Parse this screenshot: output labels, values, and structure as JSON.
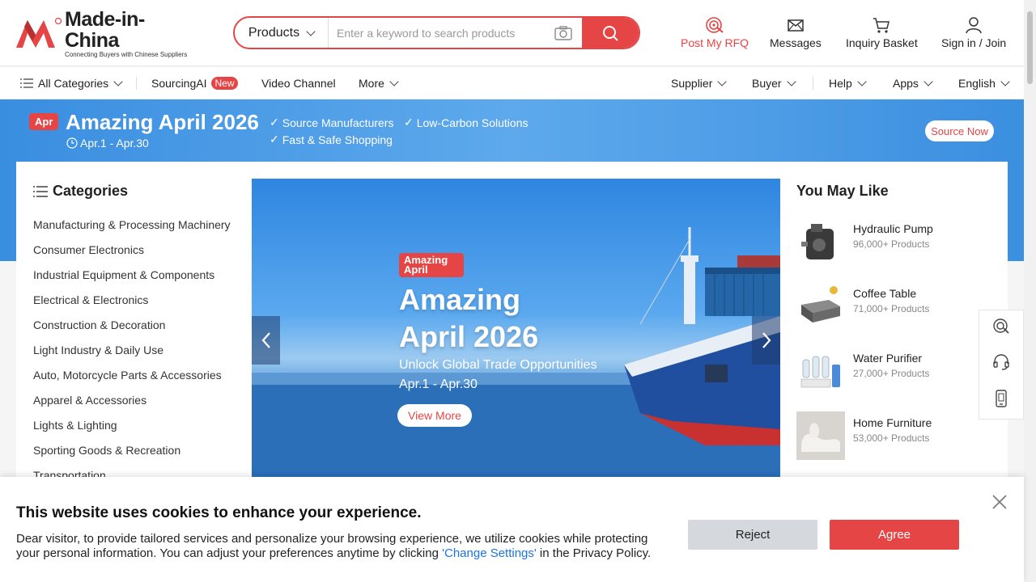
{
  "header": {
    "logo_text": "Made-in-China",
    "logo_tagline": "Connecting Buyers with Chinese Suppliers",
    "search_category": "Products",
    "search_placeholder": "Enter a keyword to search products",
    "post_rfq": "Post My RFQ",
    "messages": "Messages",
    "inquiry_basket": "Inquiry Basket",
    "sign_in": "Sign in / Join",
    "accent_color": "#e64545"
  },
  "nav": {
    "all_categories": "All Categories",
    "sourcing_ai": "SourcingAI",
    "new_badge": "New",
    "video_channel": "Video Channel",
    "more": "More",
    "supplier": "Supplier",
    "buyer": "Buyer",
    "help": "Help",
    "apps": "Apps",
    "language": "English"
  },
  "promo": {
    "tag": "Apr",
    "title": "Amazing April 2026",
    "dates": "Apr.1 - Apr.30",
    "features": [
      "Source Manufacturers",
      "Low-Carbon Solutions",
      "Fast & Safe Shopping"
    ],
    "cta": "Source Now"
  },
  "categories": {
    "title": "Categories",
    "items": [
      "Manufacturing & Processing Machinery",
      "Consumer Electronics",
      "Industrial Equipment & Components",
      "Electrical & Electronics",
      "Construction & Decoration",
      "Light Industry & Daily Use",
      "Auto, Motorcycle Parts & Accessories",
      "Apparel & Accessories",
      "Lights & Lighting",
      "Sporting Goods & Recreation",
      "Transportation"
    ]
  },
  "banner": {
    "badge": "Amazing April",
    "title_line1": "Amazing",
    "title_line2": "April 2026",
    "subtitle": "Unlock Global Trade Opportunities",
    "dates": "Apr.1 - Apr.30",
    "button": "View More"
  },
  "you_may_like": {
    "title": "You May Like",
    "items": [
      {
        "name": "Hydraulic Pump",
        "count": "96,000+ Products"
      },
      {
        "name": "Coffee Table",
        "count": "71,000+ Products"
      },
      {
        "name": "Water Purifier",
        "count": "27,000+ Products"
      },
      {
        "name": "Home Furniture",
        "count": "53,000+ Products"
      }
    ]
  },
  "cookie": {
    "title": "This website uses cookies to enhance your experience.",
    "text_before": "Dear visitor, to provide tailored services and personalize your browsing experience, we utilize cookies while protecting your personal information. You can adjust your preferences anytime by clicking ",
    "link": "'Change Settings'",
    "text_after": " in the Privacy Policy.",
    "reject": "Reject",
    "agree": "Agree"
  }
}
